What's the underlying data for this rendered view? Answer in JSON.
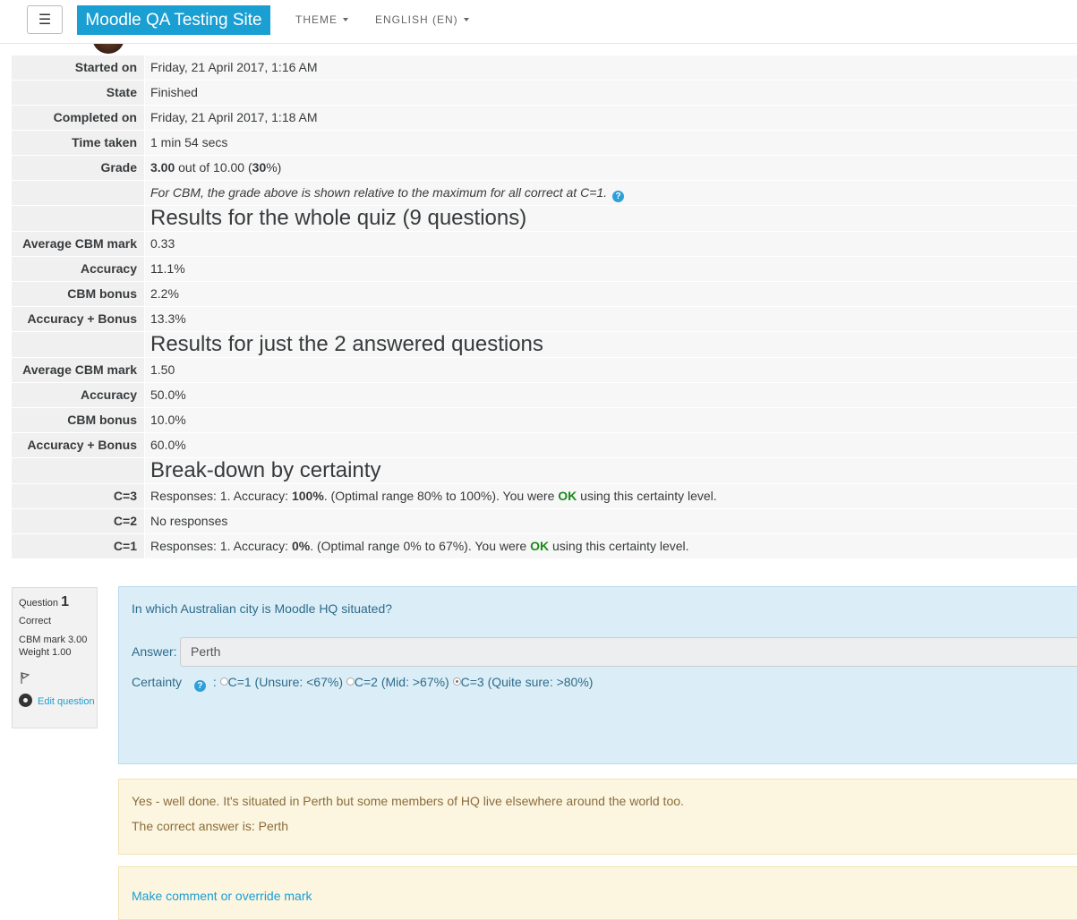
{
  "navbar": {
    "menu_icon": "hamburger-icon",
    "menu_glyph": "☰",
    "site_name": "Moodle QA Testing Site",
    "theme_label": "THEME",
    "language_label": "ENGLISH (EN)"
  },
  "summary": {
    "started_on_label": "Started on",
    "started_on": "Friday, 21 April 2017, 1:16 AM",
    "state_label": "State",
    "state": "Finished",
    "completed_on_label": "Completed on",
    "completed_on": "Friday, 21 April 2017, 1:18 AM",
    "time_taken_label": "Time taken",
    "time_taken": "1 min 54 secs",
    "grade_label": "Grade",
    "grade_value": "3.00",
    "grade_out_of": " out of 10.00 (",
    "grade_percent": "30",
    "grade_close": "%)",
    "cbm_note": "For CBM, the grade above is shown relative to the maximum for all correct at C=1.",
    "whole_heading": "Results for the whole quiz (9 questions)",
    "whole": {
      "avg_label": "Average CBM mark",
      "avg": "0.33",
      "acc_label": "Accuracy",
      "acc": "11.1%",
      "bonus_label": "CBM bonus",
      "bonus": "2.2%",
      "accb_label": "Accuracy + Bonus",
      "accb": "13.3%"
    },
    "answered_heading": "Results for just the 2 answered questions",
    "answered": {
      "avg_label": "Average CBM mark",
      "avg": "1.50",
      "acc_label": "Accuracy",
      "acc": "50.0%",
      "bonus_label": "CBM bonus",
      "bonus": "10.0%",
      "accb_label": "Accuracy + Bonus",
      "accb": "60.0%"
    },
    "breakdown_heading": "Break-down by certainty",
    "c3_label": "C=3",
    "c3_a": "Responses: 1. Accuracy: ",
    "c3_acc": "100%",
    "c3_b": ". (Optimal range 80% to 100%). You were ",
    "c3_ok": "OK",
    "c3_c": " using this certainty level.",
    "c2_label": "C=2",
    "c2": "No responses",
    "c1_label": "C=1",
    "c1_a": "Responses: 1. Accuracy: ",
    "c1_acc": "0%",
    "c1_b": ". (Optimal range 0% to 67%). You were ",
    "c1_ok": "OK",
    "c1_c": " using this certainty level."
  },
  "question": {
    "label": "Question",
    "number": "1",
    "status": "Correct",
    "cbm_mark": "CBM mark 3.00",
    "weight": "Weight 1.00",
    "edit_label": "Edit question",
    "text": "In which Australian city is Moodle HQ situated?",
    "answer_label": "Answer:",
    "answer_value": "Perth",
    "certainty_label": "Certainty",
    "certainty_options": [
      "C=1 (Unsure: <67%)",
      "C=2 (Mid: >67%)",
      "C=3 (Quite sure: >80%)"
    ],
    "selected_option": "C=3 (Quite sure: >80%)",
    "feedback": "Yes - well done. It's situated in Perth but some members of HQ live elsewhere around the world too.",
    "right_answer": "The correct answer is: Perth",
    "comment_link": "Make comment or override mark"
  },
  "colors": {
    "brand": "#1a9fd3",
    "ok": "#1a8c1a",
    "question_bg": "#dbeef7",
    "feedback_bg": "#fcf5e0"
  }
}
